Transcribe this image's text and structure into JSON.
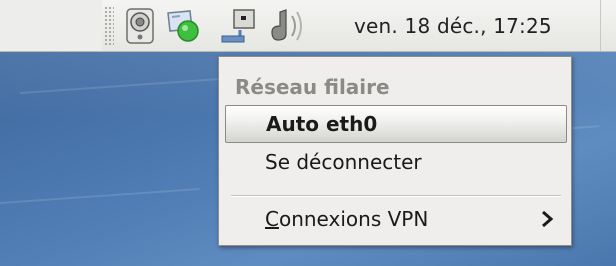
{
  "panel": {
    "clock": "ven. 18 déc., 17:25",
    "tray_icons": [
      "speaker-icon",
      "network-icon",
      "network-manager-icon",
      "volume-icon"
    ]
  },
  "menu": {
    "header": "Réseau filaire",
    "items": [
      {
        "label": "Auto eth0",
        "selected": true
      },
      {
        "label": "Se déconnecter",
        "selected": false
      }
    ],
    "vpn": {
      "mnemonic": "C",
      "rest": "onnexions VPN",
      "has_submenu": true
    }
  },
  "colors": {
    "desktop": "#4a73a8",
    "menu_background": "#efeeec",
    "header_text": "#8a8a86",
    "notification_green": "#3fbf3f"
  }
}
